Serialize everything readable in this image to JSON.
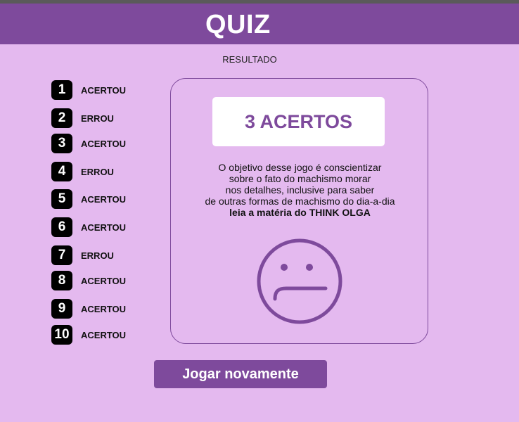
{
  "header": {
    "title": "QUIZ"
  },
  "subtitle": "RESULTADO",
  "results": [
    {
      "number": "1",
      "status": "ACERTOU"
    },
    {
      "number": "2",
      "status": "ERROU"
    },
    {
      "number": "3",
      "status": "ACERTOU"
    },
    {
      "number": "4",
      "status": "ERROU"
    },
    {
      "number": "5",
      "status": "ACERTOU"
    },
    {
      "number": "6",
      "status": "ACERTOU"
    },
    {
      "number": "7",
      "status": "ERROU"
    },
    {
      "number": "8",
      "status": "ACERTOU"
    },
    {
      "number": "9",
      "status": "ACERTOU"
    },
    {
      "number": "10",
      "status": "ACERTOU"
    }
  ],
  "card": {
    "score": "3 ACERTOS",
    "message_lines": [
      "O objetivo desse jogo é conscientizar",
      "sobre o fato do machismo morar",
      "nos detalhes, inclusive para saber",
      "de outras formas de machismo do dia-a-dia"
    ],
    "message_bold": "leia a matéria do THINK OLGA",
    "face_icon": "sad-face-icon"
  },
  "replay_button": {
    "label": "Jogar novamente"
  },
  "colors": {
    "background": "#e4b9ef",
    "accent": "#7e4a9c",
    "badge": "#000000"
  }
}
